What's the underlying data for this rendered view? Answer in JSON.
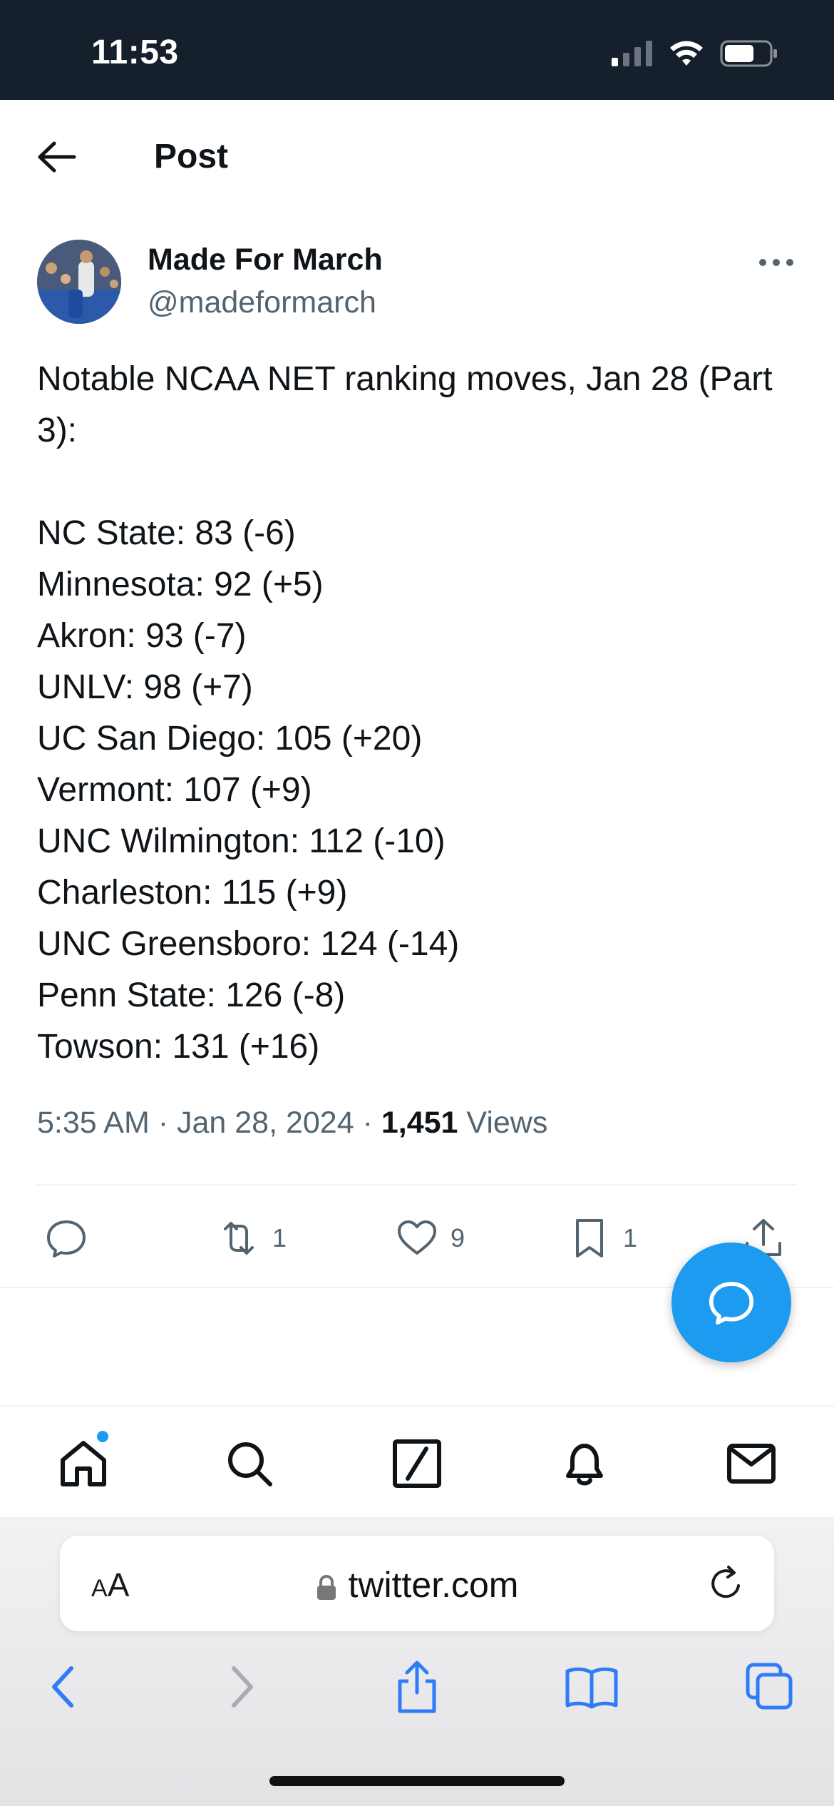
{
  "status_bar": {
    "time": "11:53"
  },
  "header": {
    "title": "Post"
  },
  "author": {
    "name": "Made For March",
    "handle": "@madeformarch"
  },
  "tweet": {
    "intro": "Notable NCAA NET ranking moves, Jan 28 (Part 3):",
    "lines": [
      "NC State: 83 (-6)",
      "Minnesota: 92 (+5)",
      "Akron: 93 (-7)",
      "UNLV: 98 (+7)",
      "UC San Diego: 105 (+20)",
      "Vermont: 107 (+9)",
      "UNC Wilmington: 112 (-10)",
      "Charleston: 115 (+9)",
      "UNC Greensboro: 124 (-14)",
      "Penn State: 126 (-8)",
      "Towson: 131 (+16)"
    ]
  },
  "meta": {
    "time": "5:35 AM · Jan 28, 2024 · ",
    "views_count": "1,451",
    "views_label": " Views"
  },
  "actions": {
    "retweets": "1",
    "likes": "9",
    "bookmarks": "1"
  },
  "browser": {
    "aa_small": "A",
    "aa_large": "A",
    "url": "twitter.com"
  },
  "colors": {
    "accent": "#1d9bf0",
    "text": "#0f1419",
    "secondary": "#536471",
    "status_bar_bg": "#16202c",
    "safari_blue": "#2f7cf6"
  },
  "icons": {
    "back": "arrow-left-icon",
    "more": "more-horizontal-icon",
    "reply": "reply-icon",
    "retweet": "retweet-icon",
    "like": "heart-icon",
    "bookmark": "bookmark-icon",
    "share": "share-icon",
    "compose": "compose-reply-icon",
    "home": "home-icon",
    "search": "search-icon",
    "grok": "grok-icon",
    "notifications": "bell-icon",
    "messages": "mail-icon"
  }
}
